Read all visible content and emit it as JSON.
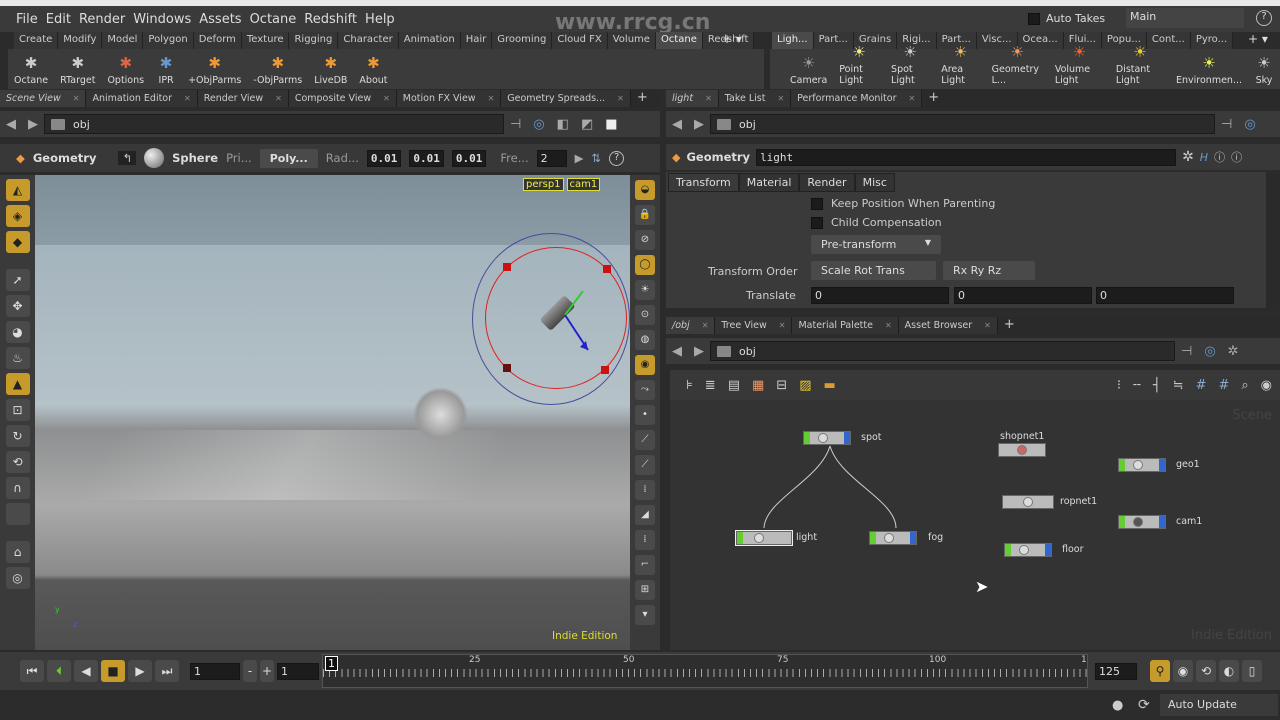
{
  "menu": [
    "File",
    "Edit",
    "Render",
    "Windows",
    "Assets",
    "Octane",
    "Redshift",
    "Help"
  ],
  "auto_takes": "Auto Takes",
  "take": "Main",
  "watermark": "www.rrcg.cn",
  "shelf_left_tabs": [
    "Create",
    "Modify",
    "Model",
    "Polygon",
    "Deform",
    "Texture",
    "Rigging",
    "Character",
    "Animation",
    "Hair",
    "Grooming",
    "Cloud FX",
    "Volume",
    "Octane",
    "Redshift"
  ],
  "shelf_left_tools": [
    "Octane",
    "RTarget",
    "Options",
    "IPR",
    "+ObjParms",
    "-ObjParms",
    "LiveDB",
    "About"
  ],
  "shelf_right_tabs": [
    "Ligh...",
    "Part...",
    "Grains",
    "Rigi...",
    "Part...",
    "Visc...",
    "Ocea...",
    "Flui...",
    "Popu...",
    "Cont...",
    "Pyro..."
  ],
  "shelf_right_tools": [
    "Camera",
    "Point Light",
    "Spot Light",
    "Area Light",
    "Geometry L...",
    "Volume Light",
    "Distant Light",
    "Environmen...",
    "Sky"
  ],
  "left_pane": {
    "tabs": [
      "Scene View",
      "Animation Editor",
      "Render View",
      "Composite View",
      "Motion FX View",
      "Geometry Spreads..."
    ],
    "path": "obj",
    "toolbar": {
      "context": "Geometry",
      "shape": "Sphere",
      "prim_label": "Pri...",
      "prim_type": "Poly...",
      "rad_label": "Rad...",
      "rad": [
        "0.01",
        "0.01",
        "0.01"
      ],
      "freq_label": "Fre...",
      "freq": "2"
    },
    "camera": "persp1",
    "cam": "cam1",
    "edition": "Indie Edition",
    "axis_y": "y",
    "axis_z": "z"
  },
  "param_pane": {
    "tabs": [
      "light",
      "Take List",
      "Performance Monitor"
    ],
    "path": "obj",
    "node_type": "Geometry",
    "node_name": "light",
    "param_tabs": [
      "Transform",
      "Material",
      "Render",
      "Misc"
    ],
    "keep_position": "Keep Position When Parenting",
    "child_comp": "Child Compensation",
    "pretransform": "Pre-transform",
    "transform_order_label": "Transform Order",
    "transform_order": "Scale Rot Trans",
    "rot_order": "Rx Ry Rz",
    "translate_label": "Translate",
    "translate": [
      "0",
      "0",
      "0"
    ]
  },
  "network_pane": {
    "tabs": [
      "/obj",
      "Tree View",
      "Material Palette",
      "Asset Browser"
    ],
    "path": "obj",
    "corner_label": "Scene",
    "edition": "Indie Edition",
    "nodes": [
      "spot",
      "shopnet1",
      "geo1",
      "ropnet1",
      "cam1",
      "light",
      "fog",
      "floor"
    ]
  },
  "timeline": {
    "frame": "1",
    "start": "1",
    "ticks": [
      "1",
      "25",
      "50",
      "75",
      "100"
    ],
    "end_tick": "1",
    "end": "125"
  },
  "status": {
    "update": "Auto Update"
  },
  "colors": {
    "accent": "#c69a2b",
    "node_green": "#66cc33",
    "node_blue": "#3366cc",
    "handle_red": "#cc2222"
  }
}
